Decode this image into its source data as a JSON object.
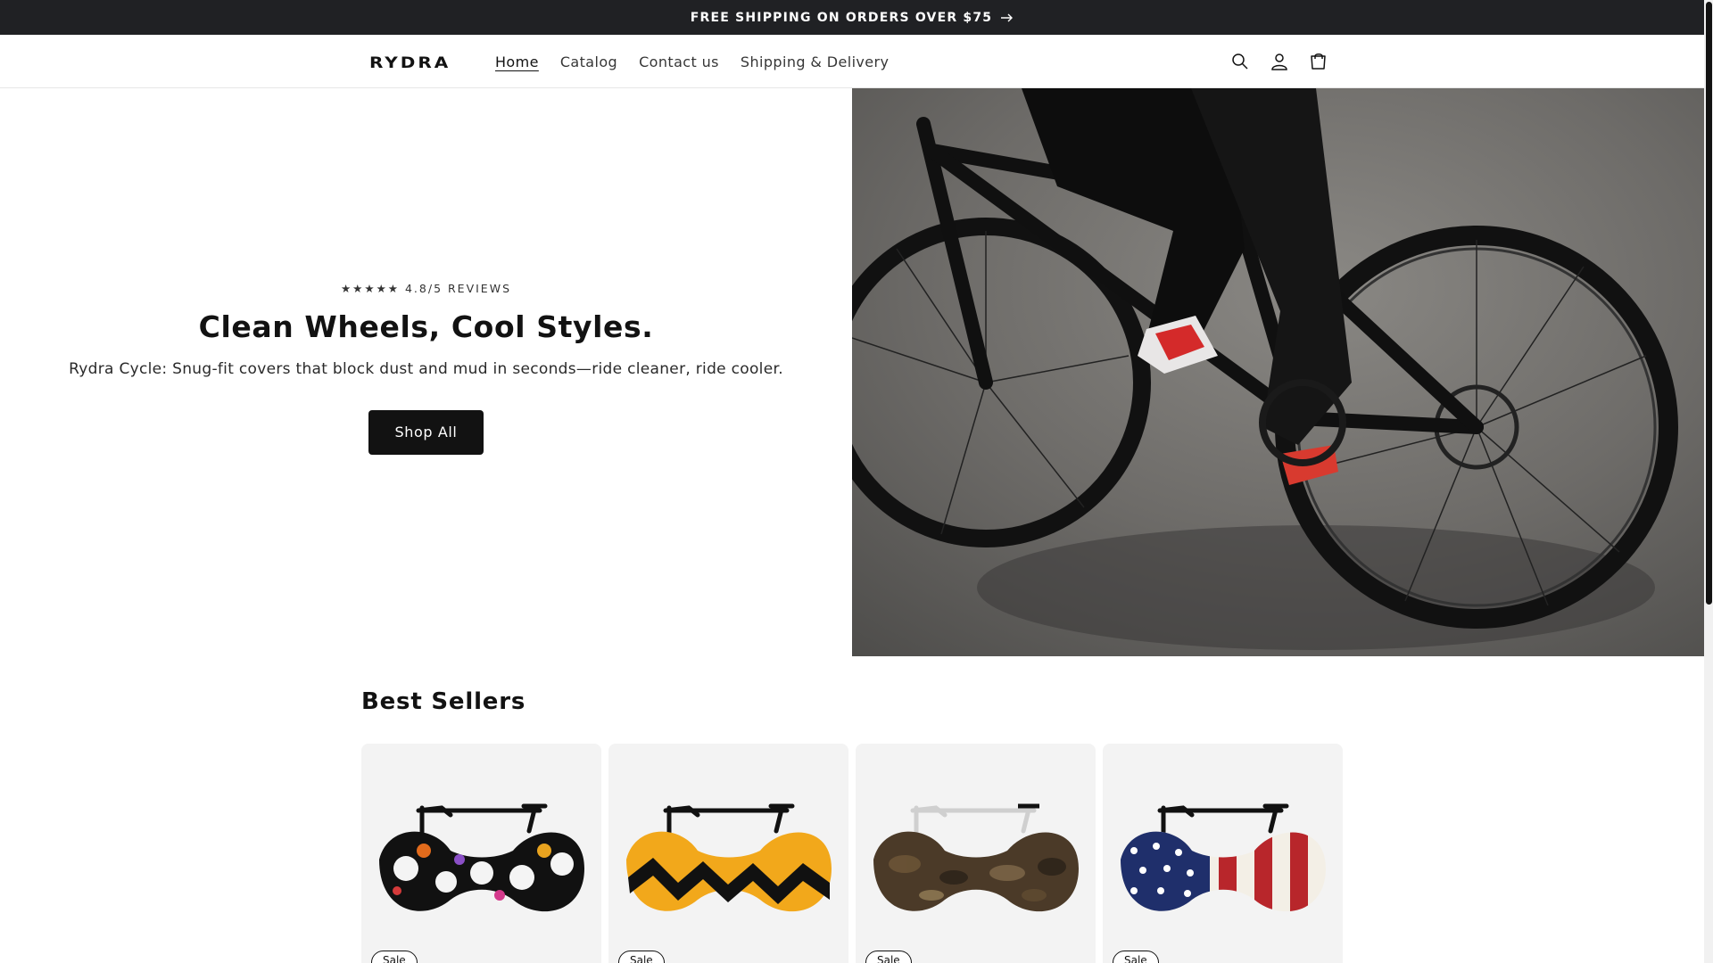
{
  "announcement": {
    "text": "FREE SHIPPING ON ORDERS OVER $75"
  },
  "header": {
    "logo": "RYDRA",
    "nav": [
      "Home",
      "Catalog",
      "Contact us",
      "Shipping & Delivery"
    ],
    "active_nav": "Home",
    "icons": [
      "search-icon",
      "account-icon",
      "cart-icon"
    ]
  },
  "hero": {
    "rating": "★★★★★ 4.8/5 REVIEWS",
    "title": "Clean Wheels, Cool Styles.",
    "subtitle": "Rydra Cycle: Snug-fit covers that block dust and mud in seconds—ride cleaner, ride cooler.",
    "button_label": "Shop All"
  },
  "best_sellers": {
    "title": "Best Sellers",
    "products": [
      {
        "pattern": "sugar-skulls",
        "badge": "Sale"
      },
      {
        "pattern": "zigzag",
        "badge": "Sale"
      },
      {
        "pattern": "camo",
        "badge": "Sale"
      },
      {
        "pattern": "american-flag",
        "badge": "Sale"
      }
    ]
  },
  "colors": {
    "announcement_bg": "#202124",
    "button_bg": "#121212",
    "card_bg": "#f3f3f3"
  }
}
